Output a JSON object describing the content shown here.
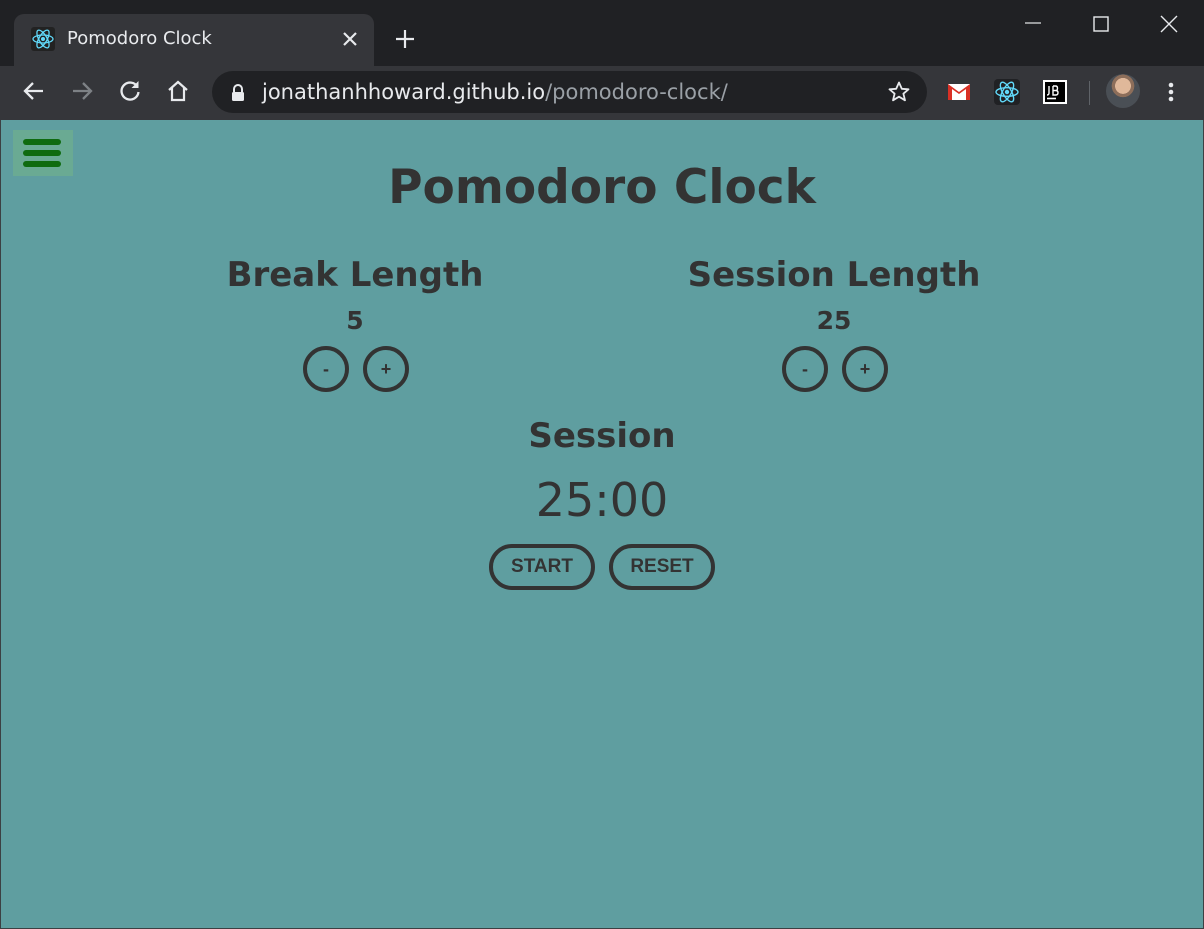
{
  "browser": {
    "tab": {
      "title": "Pomodoro Clock"
    },
    "url": {
      "host": "jonathanhhoward.github.io",
      "path": "/pomodoro-clock/"
    },
    "extensions": [
      "gmail-icon",
      "react-devtools-icon",
      "jetbrains-icon"
    ]
  },
  "app": {
    "title": "Pomodoro Clock",
    "break": {
      "label": "Break Length",
      "value": "5",
      "decrement": "-",
      "increment": "+"
    },
    "session": {
      "label": "Session Length",
      "value": "25",
      "decrement": "-",
      "increment": "+"
    },
    "timer": {
      "label": "Session",
      "time": "25:00"
    },
    "controls": {
      "start": "START",
      "reset": "RESET"
    }
  },
  "colors": {
    "page_bg": "#5f9ea0",
    "text": "#333333",
    "menu_bg": "#6aaa93",
    "menu_bars": "#0f6b0f"
  }
}
